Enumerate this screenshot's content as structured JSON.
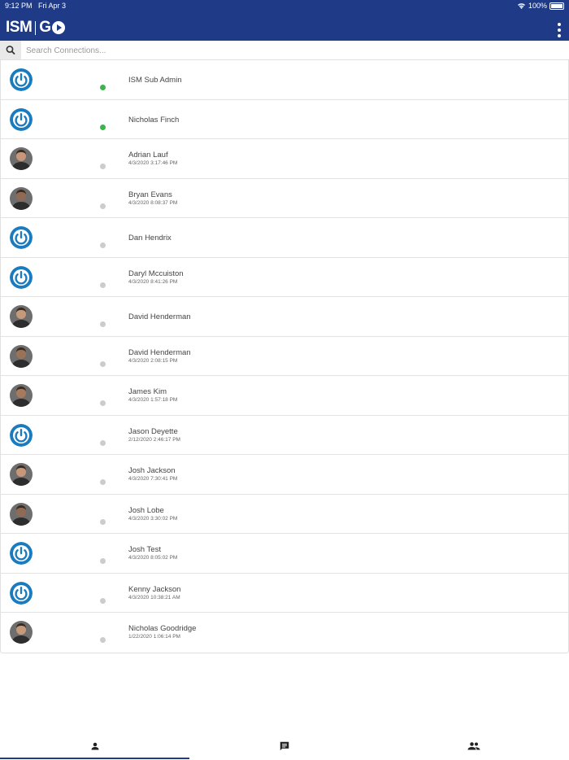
{
  "status_bar": {
    "time": "9:12 PM",
    "date": "Fri Apr 3",
    "battery": "100%"
  },
  "header": {
    "logo_text_left": "ISM",
    "logo_text_right": "G",
    "menu_icon": "more-vertical-icon",
    "background_color": "#1f3a87"
  },
  "search": {
    "placeholder": "Search Connections...",
    "value": "",
    "icon": "search-icon"
  },
  "colors": {
    "online": "#3bb54a",
    "offline": "#cccccc",
    "default_avatar_blue": "#1a7bbf",
    "tab_active": "#1f3a87"
  },
  "connections": [
    {
      "name": "ISM Sub Admin",
      "last_seen": "",
      "status": "online",
      "avatar": "power-logo"
    },
    {
      "name": "Nicholas Finch",
      "last_seen": "",
      "status": "online",
      "avatar": "power-logo"
    },
    {
      "name": "Adrian Lauf",
      "last_seen": "4/3/2020 3:17:46 PM",
      "status": "offline",
      "avatar": "photo"
    },
    {
      "name": "Bryan Evans",
      "last_seen": "4/3/2020 8:08:37 PM",
      "status": "offline",
      "avatar": "photo"
    },
    {
      "name": "Dan Hendrix",
      "last_seen": "",
      "status": "offline",
      "avatar": "power-logo"
    },
    {
      "name": "Daryl Mccuiston",
      "last_seen": "4/3/2020 8:41:26 PM",
      "status": "offline",
      "avatar": "power-logo"
    },
    {
      "name": "David Henderman",
      "last_seen": "",
      "status": "offline",
      "avatar": "photo"
    },
    {
      "name": "David Henderman",
      "last_seen": "4/3/2020 2:08:15 PM",
      "status": "offline",
      "avatar": "photo"
    },
    {
      "name": "James Kim",
      "last_seen": "4/3/2020 1:57:18 PM",
      "status": "offline",
      "avatar": "photo"
    },
    {
      "name": "Jason Deyette",
      "last_seen": "2/12/2020 2:46:17 PM",
      "status": "offline",
      "avatar": "power-logo"
    },
    {
      "name": "Josh Jackson",
      "last_seen": "4/3/2020 7:30:41 PM",
      "status": "offline",
      "avatar": "photo"
    },
    {
      "name": "Josh Lobe",
      "last_seen": "4/3/2020 3:30:02 PM",
      "status": "offline",
      "avatar": "photo"
    },
    {
      "name": "Josh Test",
      "last_seen": "4/3/2020 8:05:02 PM",
      "status": "offline",
      "avatar": "power-logo"
    },
    {
      "name": "Kenny Jackson",
      "last_seen": "4/3/2020 10:38:21 AM",
      "status": "offline",
      "avatar": "power-logo"
    },
    {
      "name": "Nicholas Goodridge",
      "last_seen": "1/22/2020 1:06:14 PM",
      "status": "offline",
      "avatar": "photo"
    }
  ],
  "tabs": [
    {
      "icon": "person-icon",
      "active": true
    },
    {
      "icon": "chat-icon",
      "active": false
    },
    {
      "icon": "people-icon",
      "active": false
    }
  ]
}
